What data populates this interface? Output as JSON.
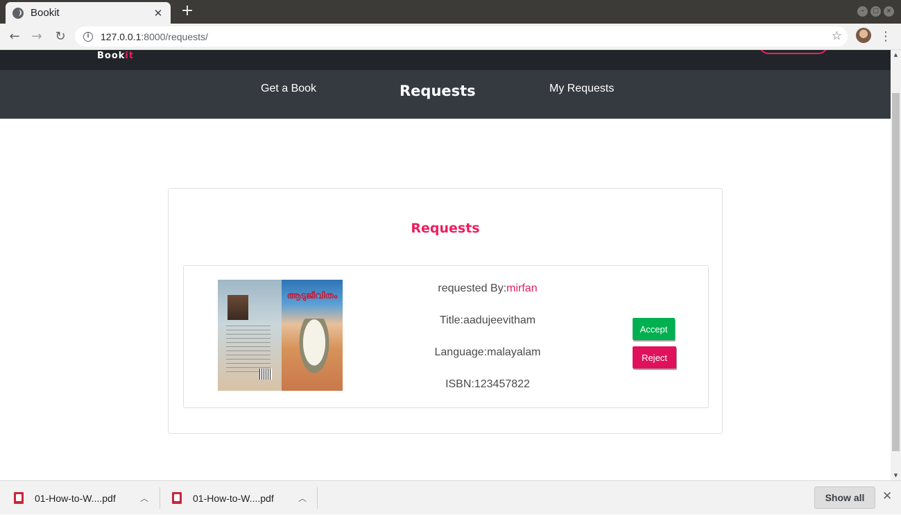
{
  "browser": {
    "tab_title": "Bookit",
    "tab_close": "✕",
    "new_tab": "+",
    "url_host": "127.0.0.1",
    "url_path": ":8000/requests/",
    "icons": {
      "back": "back-arrow-icon",
      "forward": "forward-arrow-icon",
      "reload": "reload-icon",
      "info": "info-icon",
      "star": "star-icon",
      "menu": "kebab-menu-icon"
    }
  },
  "site": {
    "brand_main": "Book",
    "brand_accent": "it",
    "accent_color": "#ee1d5e",
    "nav": {
      "get_book": "Get a Book",
      "requests": "Requests",
      "my_requests": "My Requests"
    }
  },
  "requests_card": {
    "title": "Requests",
    "items": [
      {
        "requested_by_label": "requested By:",
        "requested_by_user": "mirfan",
        "title": "Title:aadujeevitham",
        "language": "Language:malayalam",
        "isbn": "ISBN:123457822",
        "cover_title": "ആടുജീവിതം",
        "accept_label": "Accept",
        "reject_label": "Reject"
      }
    ]
  },
  "downloads": {
    "items": [
      {
        "name": "01-How-to-W....pdf"
      },
      {
        "name": "01-How-to-W....pdf"
      }
    ],
    "show_all": "Show all",
    "close": "✕"
  }
}
